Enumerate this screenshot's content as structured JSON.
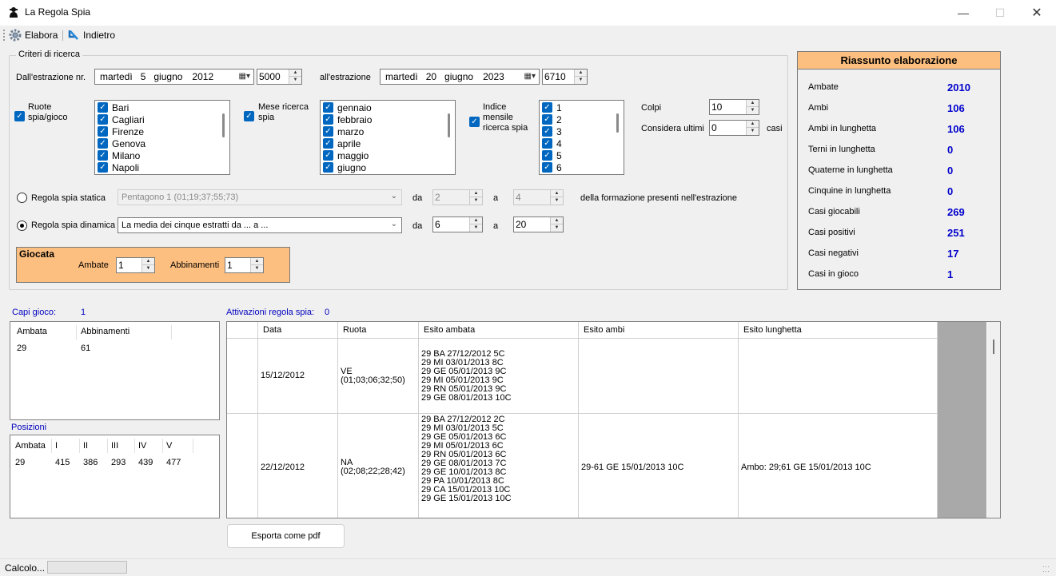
{
  "window": {
    "title": "La Regola Spia"
  },
  "toolbar": {
    "elabora": "Elabora",
    "indietro": "Indietro"
  },
  "criteri": {
    "legend": "Criteri di ricerca",
    "dall_label": "Dall'estrazione nr.",
    "dall_date": {
      "day": "martedì",
      "num": "5",
      "month": "giugno",
      "year": "2012"
    },
    "dall_nr": "5000",
    "all_label": "all'estrazione",
    "all_date": {
      "day": "martedì",
      "num": "20",
      "month": "giugno",
      "year": "2023"
    },
    "all_nr": "6710",
    "ruote_label": "Ruote spia/gioco",
    "ruote": [
      "Bari",
      "Cagliari",
      "Firenze",
      "Genova",
      "Milano",
      "Napoli"
    ],
    "mese_label": "Mese ricerca spia",
    "mesi": [
      "gennaio",
      "febbraio",
      "marzo",
      "aprile",
      "maggio",
      "giugno"
    ],
    "indice_label": "Indice mensile ricerca spia",
    "indici": [
      "1",
      "2",
      "3",
      "4",
      "5",
      "6"
    ],
    "colpi_label": "Colpi",
    "colpi": "10",
    "considera_label": "Considera ultimi",
    "considera": "0",
    "casi_label": "casi",
    "statica_label": "Regola spia statica",
    "statica_combo": "Pentagono 1 (01;19;37;55;73)",
    "dinamica_label": "Regola spia dinamica",
    "dinamica_combo": "La media dei cinque estratti da ... a ...",
    "da_label": "da",
    "a_label": "a",
    "statica_da": "2",
    "statica_a": "4",
    "dinamica_da": "6",
    "dinamica_a": "20",
    "formazione_label": "della formazione presenti nell'estrazione"
  },
  "giocata": {
    "title": "Giocata",
    "ambate_label": "Ambate",
    "ambate": "1",
    "abbinamenti_label": "Abbinamenti",
    "abbinamenti": "1"
  },
  "riassunto": {
    "title": "Riassunto elaborazione",
    "rows": [
      {
        "label": "Ambate",
        "value": "2010"
      },
      {
        "label": "Ambi",
        "value": "106"
      },
      {
        "label": "Ambi in lunghetta",
        "value": "106"
      },
      {
        "label": "Terni in lunghetta",
        "value": "0"
      },
      {
        "label": "Quaterne in lunghetta",
        "value": "0"
      },
      {
        "label": "Cinquine in lunghetta",
        "value": "0"
      },
      {
        "label": "Casi giocabili",
        "value": "269"
      },
      {
        "label": "Casi positivi",
        "value": "251"
      },
      {
        "label": "Casi negativi",
        "value": "17"
      },
      {
        "label": "Casi in gioco",
        "value": "1"
      }
    ]
  },
  "capi": {
    "label": "Capi gioco:",
    "count": "1",
    "headers": [
      "Ambata",
      "Abbinamenti"
    ],
    "row": [
      "29",
      "61"
    ]
  },
  "posizioni": {
    "label": "Posizioni",
    "headers": [
      "Ambata",
      "I",
      "II",
      "III",
      "IV",
      "V"
    ],
    "row": [
      "29",
      "415",
      "386",
      "293",
      "439",
      "477"
    ]
  },
  "attivazioni": {
    "label": "Attivazioni regola spia:",
    "count": "0",
    "headers": [
      "Data",
      "Ruota",
      "Esito ambata",
      "Esito ambi",
      "Esito lunghetta"
    ],
    "rows": [
      {
        "data": "15/12/2012",
        "ruota": "VE\n(01;03;06;32;50)",
        "ambata": "29 BA  27/12/2012  5C\n29 MI  03/01/2013  8C\n29 GE  05/01/2013  9C\n29 MI  05/01/2013  9C\n29 RN  05/01/2013  9C\n29 GE  08/01/2013  10C",
        "ambi": "",
        "lunghetta": ""
      },
      {
        "data": "22/12/2012",
        "ruota": "NA\n(02;08;22;28;42)",
        "ambata": "29 BA  27/12/2012  2C\n29 MI  03/01/2013  5C\n29 GE  05/01/2013  6C\n29 MI  05/01/2013  6C\n29 RN  05/01/2013  6C\n29 GE  08/01/2013  7C\n29 GE  10/01/2013  8C\n29 PA  10/01/2013  8C\n29 CA  15/01/2013  10C\n29 GE  15/01/2013  10C",
        "ambi": "29-61 GE  15/01/2013  10C",
        "lunghetta": "Ambo: 29;61 GE  15/01/2013  10C"
      }
    ]
  },
  "export_button": "Esporta come pdf",
  "status": {
    "text": "Calcolo...",
    "progress": 0
  }
}
